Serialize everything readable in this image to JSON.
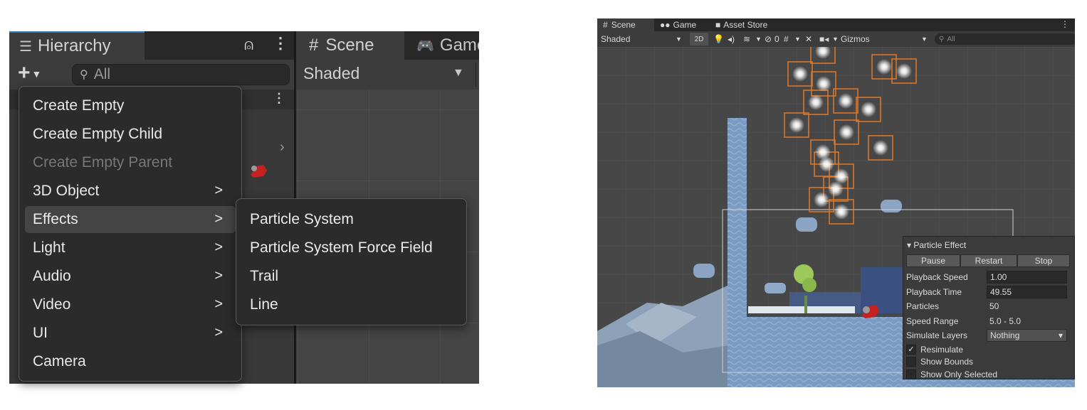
{
  "hierarchy": {
    "tab_label": "Hierarchy",
    "search_placeholder": "All"
  },
  "scene_left": {
    "tab_scene": "Scene",
    "tab_game": "Game",
    "shading_mode": "Shaded"
  },
  "create_menu": {
    "items": [
      {
        "label": "Create Empty",
        "enabled": true,
        "submenu": false
      },
      {
        "label": "Create Empty Child",
        "enabled": true,
        "submenu": false
      },
      {
        "label": "Create Empty Parent",
        "enabled": false,
        "submenu": false
      },
      {
        "label": "3D Object",
        "enabled": true,
        "submenu": true
      },
      {
        "label": "Effects",
        "enabled": true,
        "submenu": true,
        "active": true
      },
      {
        "label": "Light",
        "enabled": true,
        "submenu": true
      },
      {
        "label": "Audio",
        "enabled": true,
        "submenu": true
      },
      {
        "label": "Video",
        "enabled": true,
        "submenu": true
      },
      {
        "label": "UI",
        "enabled": true,
        "submenu": true
      },
      {
        "label": "Camera",
        "enabled": true,
        "submenu": false
      }
    ],
    "arrow_glyph": ">"
  },
  "effects_submenu": {
    "items": [
      "Particle System",
      "Particle System Force Field",
      "Trail",
      "Line"
    ]
  },
  "scene_right": {
    "tabs": [
      "Scene",
      "Game",
      "Asset Store"
    ],
    "shading_mode": "Shaded",
    "toggle_2d": "2D",
    "hidden_count": "0",
    "gizmos_label": "Gizmos",
    "search_placeholder": "All"
  },
  "particle_effect": {
    "title": "Particle Effect",
    "buttons": [
      "Pause",
      "Restart",
      "Stop"
    ],
    "fields": [
      {
        "label": "Playback Speed",
        "value": "1.00",
        "kind": "field"
      },
      {
        "label": "Playback Time",
        "value": "49.55",
        "kind": "field"
      },
      {
        "label": "Particles",
        "value": "50",
        "kind": "text"
      },
      {
        "label": "Speed Range",
        "value": "5.0 - 5.0",
        "kind": "text"
      },
      {
        "label": "Simulate Layers",
        "value": "Nothing",
        "kind": "dropdown"
      }
    ],
    "checkboxes": [
      {
        "label": "Resimulate",
        "checked": true
      },
      {
        "label": "Show Bounds",
        "checked": false
      },
      {
        "label": "Show Only Selected",
        "checked": false
      }
    ]
  },
  "colors": {
    "accent_tab": "#3a79bb",
    "selection_outline": "#e0782a",
    "editor_dark": "#282828",
    "panel": "#3c3c3c"
  }
}
